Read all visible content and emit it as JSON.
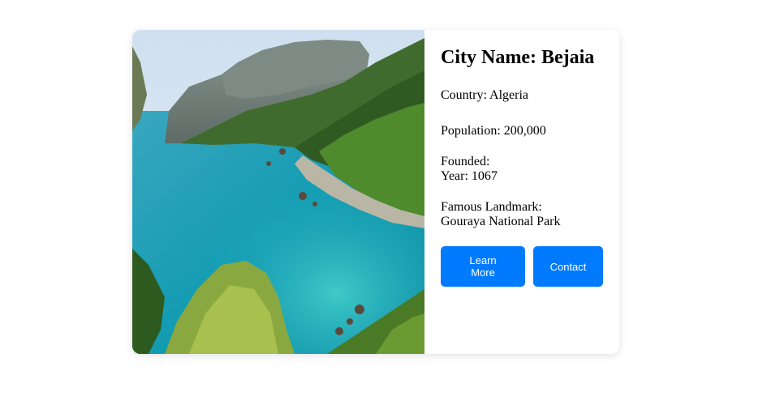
{
  "city": {
    "title": "City Name: Bejaia",
    "country": "Country: Algeria",
    "population": "Population: 200,000",
    "founded_label": "Founded:",
    "founded_year": "Year: 1067",
    "landmark_label": "Famous Landmark:",
    "landmark_name": "Gouraya National Park"
  },
  "buttons": {
    "learn_more": "Learn More",
    "contact": "Contact"
  },
  "colors": {
    "button_bg": "#007bff",
    "button_text": "#ffffff",
    "sea": "#1aa3b8",
    "cliff": "#6f7a72"
  }
}
